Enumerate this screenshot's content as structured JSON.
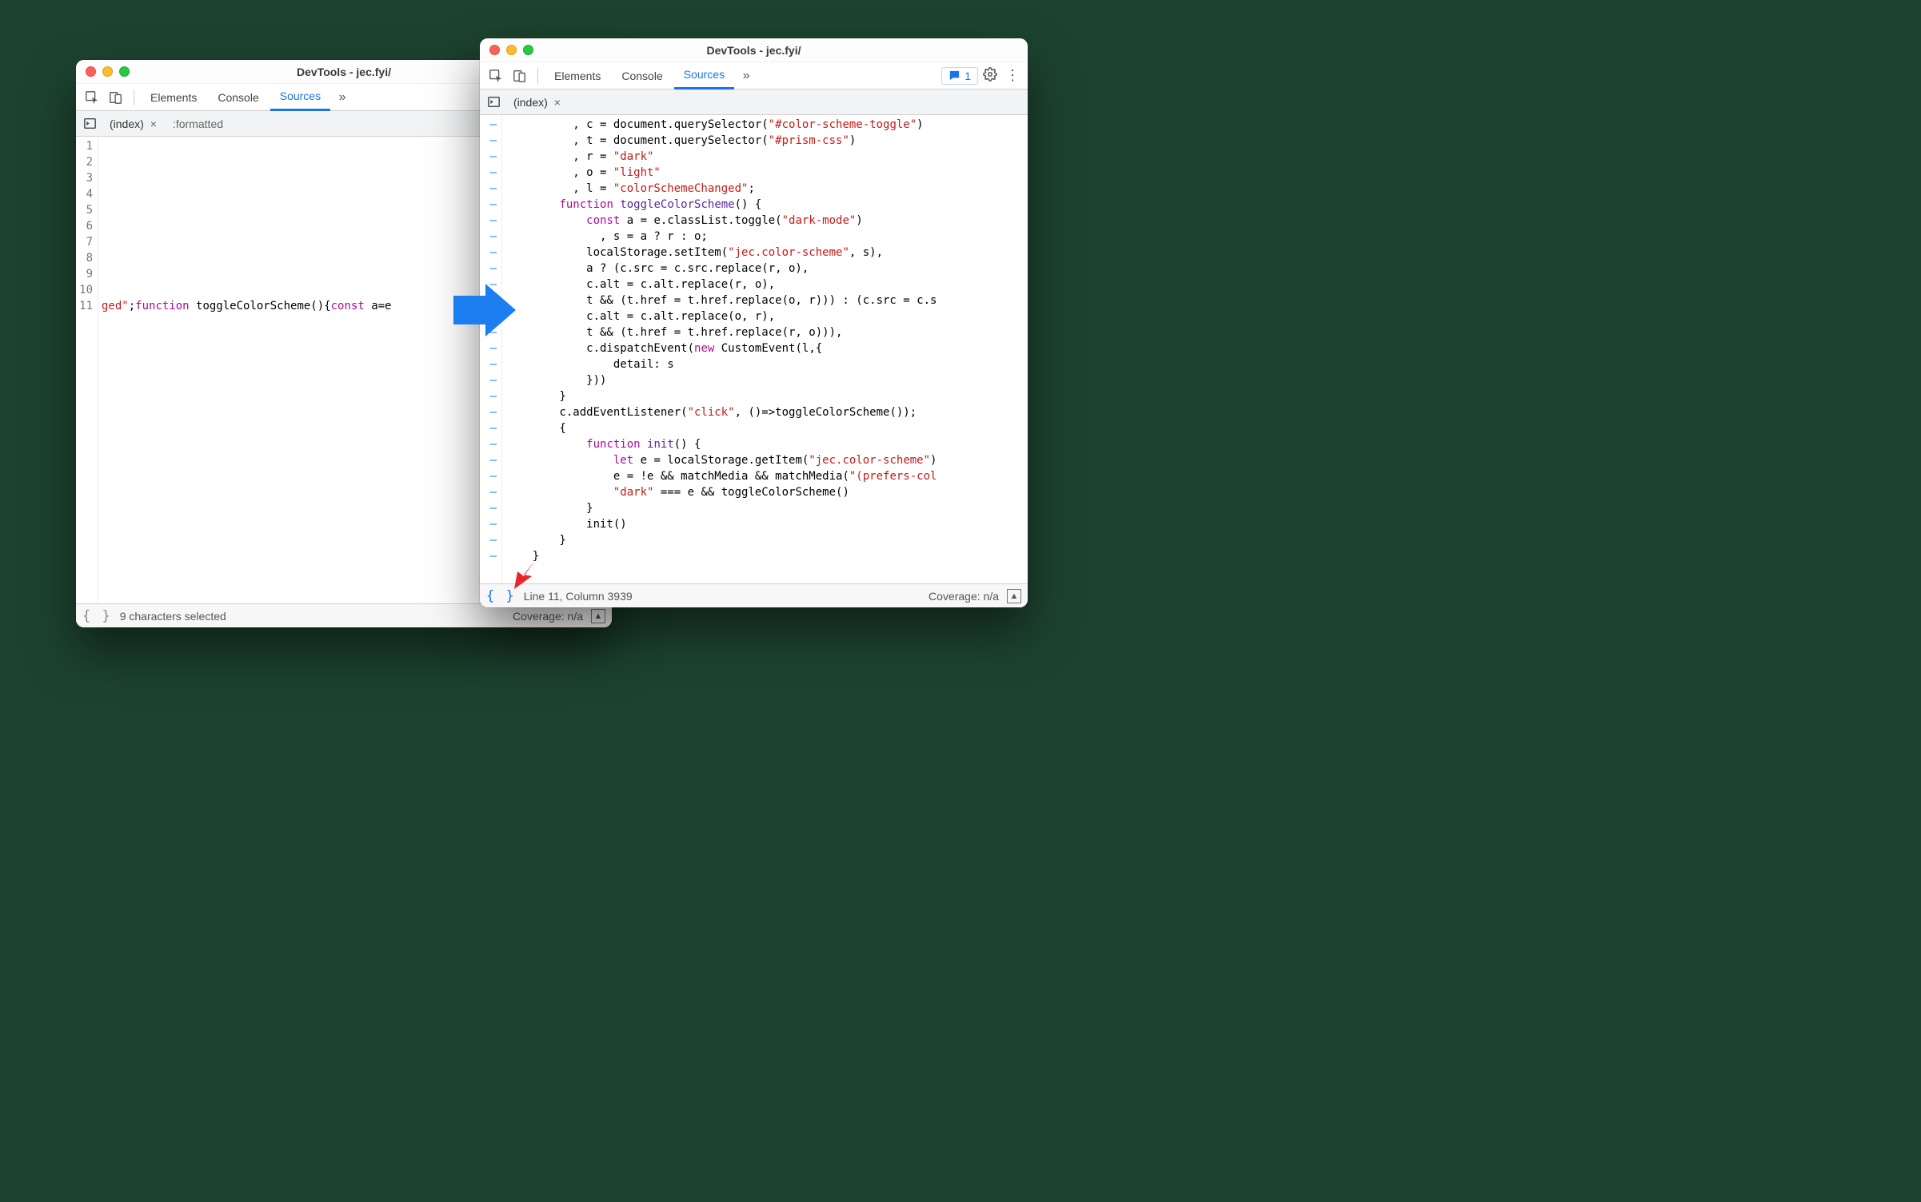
{
  "windowLeft": {
    "title": "DevTools - jec.fyi/",
    "tabs": {
      "elements": "Elements",
      "console": "Console",
      "sources": "Sources"
    },
    "fileTabs": {
      "index": "(index)",
      "formatted": ":formatted"
    },
    "lineNumbers": [
      "1",
      "2",
      "3",
      "4",
      "5",
      "6",
      "7",
      "8",
      "9",
      "10",
      "11"
    ],
    "codeFragments": {
      "l11_a": "ged\"",
      "l11_b": ";",
      "l11_c": "function",
      "l11_d": " toggleColorScheme(){",
      "l11_e": "const",
      "l11_f": " a=e"
    },
    "status": {
      "left": "9 characters selected",
      "coverage": "Coverage: n/a"
    }
  },
  "windowRight": {
    "title": "DevTools - jec.fyi/",
    "tabs": {
      "elements": "Elements",
      "console": "Console",
      "sources": "Sources"
    },
    "issuesCount": "1",
    "fileTabs": {
      "index": "(index)"
    },
    "status": {
      "left": "Line 11, Column 3939",
      "coverage": "Coverage: n/a"
    },
    "code": {
      "l1": {
        "a": "          , c = document.querySelector(",
        "b": "\"#color-scheme-toggle\"",
        "c": ")"
      },
      "l2": {
        "a": "          , t = document.querySelector(",
        "b": "\"#prism-css\"",
        "c": ")"
      },
      "l3": {
        "a": "          , r = ",
        "b": "\"dark\""
      },
      "l4": {
        "a": "          , o = ",
        "b": "\"light\""
      },
      "l5": {
        "a": "          , l = ",
        "b": "\"colorSchemeChanged\"",
        "c": ";"
      },
      "l6": {
        "a": "        ",
        "b": "function",
        "c": " ",
        "d": "toggleColorScheme",
        "e": "() {"
      },
      "l7": {
        "a": "            ",
        "b": "const",
        "c": " a = e.classList.toggle(",
        "d": "\"dark-mode\"",
        "e": ")"
      },
      "l8": {
        "a": "              , s = a ? r : o;"
      },
      "l9": {
        "a": "            localStorage.setItem(",
        "b": "\"jec.color-scheme\"",
        "c": ", s),"
      },
      "l10": {
        "a": "            a ? (c.src = c.src.replace(r, o),"
      },
      "l11": {
        "a": "            c.alt = c.alt.replace(r, o),"
      },
      "l12": {
        "a": "            t && (t.href = t.href.replace(o, r))) : (c.src = c.s"
      },
      "l13": {
        "a": "            c.alt = c.alt.replace(o, r),"
      },
      "l14": {
        "a": "            t && (t.href = t.href.replace(r, o))),"
      },
      "l15": {
        "a": "            c.dispatchEvent(",
        "b": "new",
        "c": " CustomEvent(l,{"
      },
      "l16": {
        "a": "                detail: s"
      },
      "l17": {
        "a": "            }))"
      },
      "l18": {
        "a": "        }"
      },
      "l19": {
        "a": "        c.addEventListener(",
        "b": "\"click\"",
        "c": ", ()=>toggleColorScheme());"
      },
      "l20": {
        "a": "        {"
      },
      "l21": {
        "a": "            ",
        "b": "function",
        "c": " ",
        "d": "init",
        "e": "() {"
      },
      "l22": {
        "a": "                ",
        "b": "let",
        "c": " e = localStorage.getItem(",
        "d": "\"jec.color-scheme\"",
        "e": ")"
      },
      "l23": {
        "a": "                e = !e && matchMedia && matchMedia(",
        "b": "\"(prefers-col"
      },
      "l24": {
        "a": "                ",
        "b": "\"dark\"",
        "c": " === e && toggleColorScheme()"
      },
      "l25": {
        "a": "            }"
      },
      "l26": {
        "a": "            init()"
      },
      "l27": {
        "a": "        }"
      },
      "l28": {
        "a": "    }"
      }
    }
  }
}
